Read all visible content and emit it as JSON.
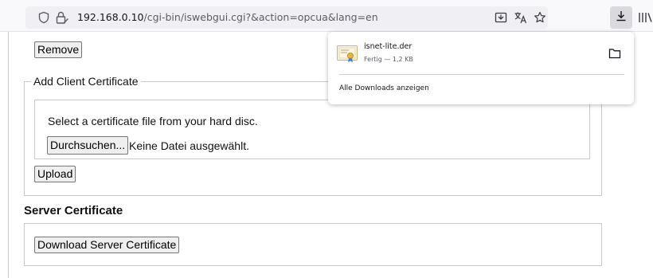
{
  "browser": {
    "url_host": "192.168.0.10",
    "url_path": "/cgi-bin/iswebgui.cgi?&action=opcua&lang=en",
    "icons": [
      "shield-icon",
      "lock-icon",
      "reader-view-icon",
      "translate-icon",
      "star-icon",
      "download-icon",
      "library-icon"
    ]
  },
  "page": {
    "remove_label": "Remove",
    "add_client_legend": "Add Client Certificate",
    "select_text": "Select a certificate file from your hard disc.",
    "browse_label": "Durchsuchen...",
    "no_file_text": "Keine Datei ausgewählt.",
    "upload_label": "Upload",
    "server_title": "Server Certificate",
    "download_server_label": "Download Server Certificate"
  },
  "downloads": {
    "file_name": "isnet-lite.der",
    "status": "Fertig — 1,2 KB",
    "show_all": "Alle Downloads anzeigen",
    "icons": [
      "certificate-file-icon",
      "folder-icon"
    ]
  }
}
